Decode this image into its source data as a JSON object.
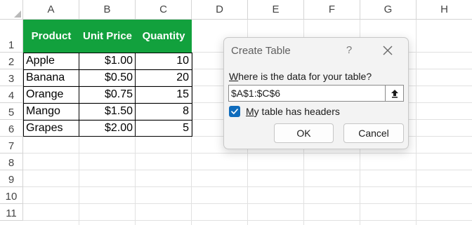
{
  "sheet": {
    "columns": [
      "A",
      "B",
      "C",
      "D",
      "E",
      "F",
      "G",
      "H"
    ],
    "rows": [
      "1",
      "2",
      "3",
      "4",
      "5",
      "6",
      "7",
      "8",
      "9",
      "10",
      "11"
    ]
  },
  "table": {
    "headers": [
      "Product",
      "Unit Price",
      "Quantity"
    ],
    "rows": [
      {
        "product": "Apple",
        "price": "$1.00",
        "quantity": "10"
      },
      {
        "product": "Banana",
        "price": "$0.50",
        "quantity": "20"
      },
      {
        "product": "Orange",
        "price": "$0.75",
        "quantity": "15"
      },
      {
        "product": "Mango",
        "price": "$1.50",
        "quantity": "8"
      },
      {
        "product": "Grapes",
        "price": "$2.00",
        "quantity": "5"
      }
    ],
    "header_color": "#12a13d"
  },
  "dialog": {
    "title": "Create Table",
    "help": "?",
    "prompt_underlined": "W",
    "prompt_rest": "here is the data for your table?",
    "range_value": "$A$1:$C$6",
    "has_headers_checked": true,
    "checkbox_underlined": "M",
    "checkbox_rest": "y table has headers",
    "ok_label": "OK",
    "cancel_label": "Cancel",
    "accent_color": "#0f6cbd"
  }
}
